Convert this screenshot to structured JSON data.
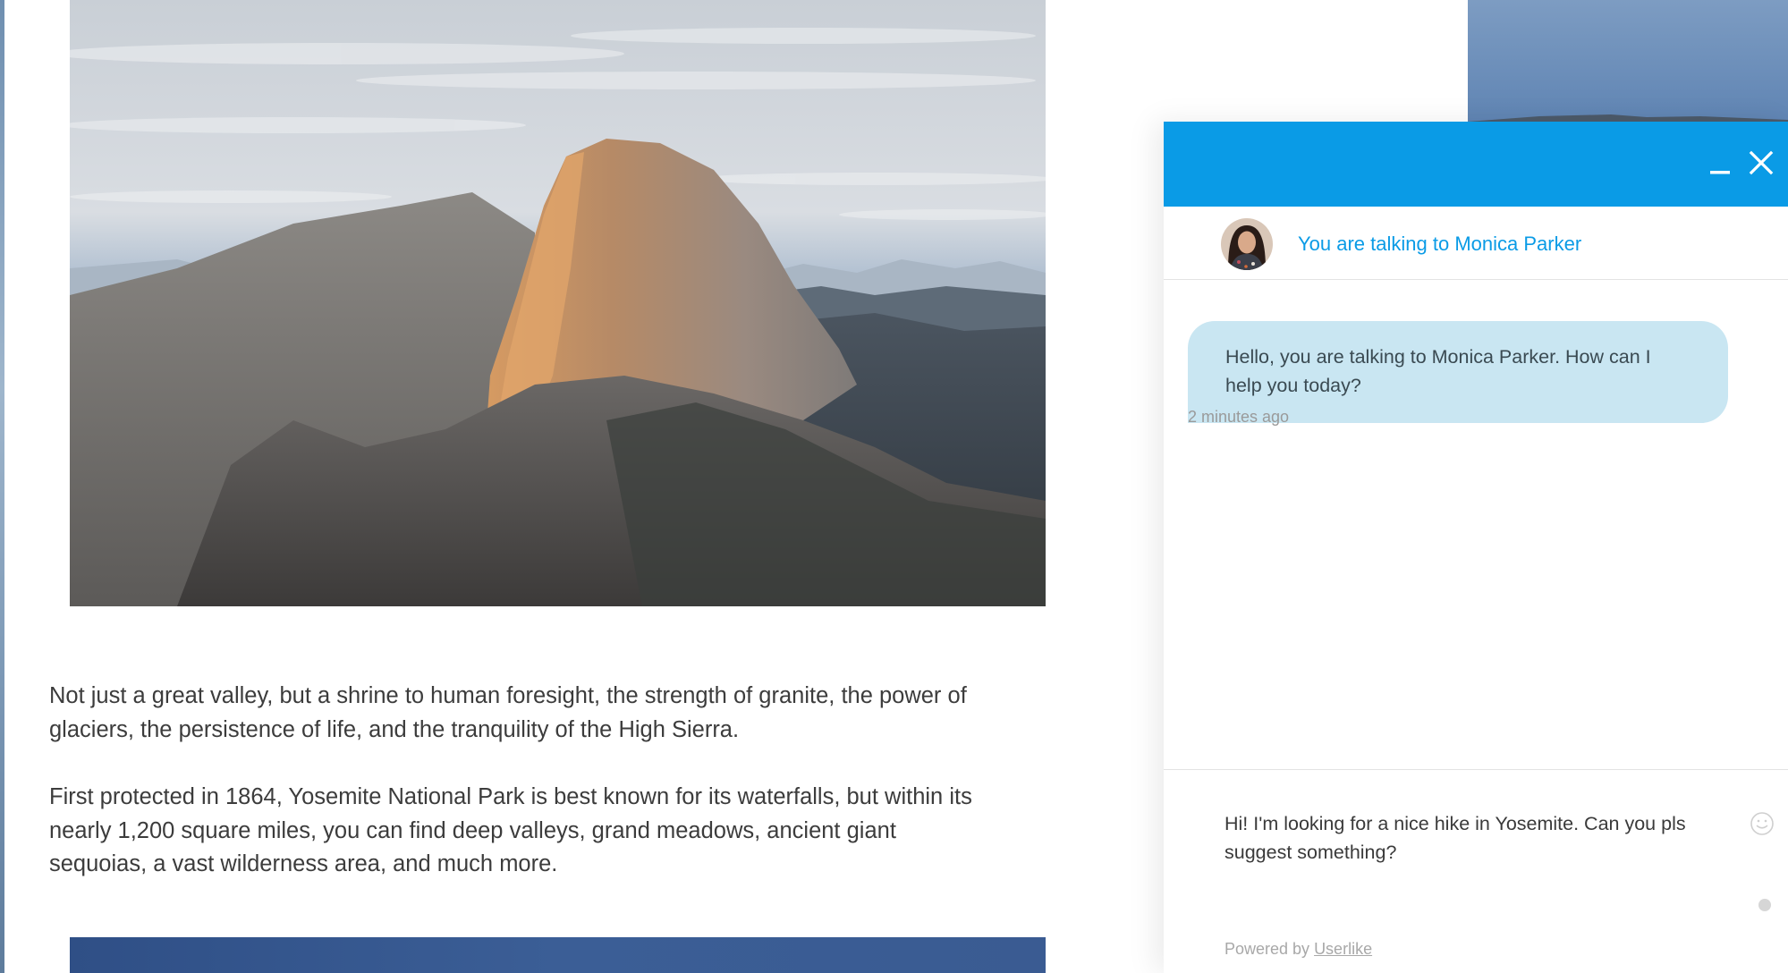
{
  "article": {
    "paragraph_1": "Not just a great valley, but a shrine to human foresight, the strength of granite, the power of glaciers, the persistence of life, and the tranquility of the High Sierra.",
    "paragraph_2": "First protected in 1864, Yosemite National Park is best known for its waterfalls, but within its nearly 1,200 square miles, you can find deep valleys, grand meadows, ancient giant sequoias, a vast wilderness area, and much more."
  },
  "chat": {
    "header": {
      "minimize_icon": "minimize-icon",
      "close_icon": "close-icon",
      "color": "#0a9be6"
    },
    "agent_bar": {
      "label": "You are talking to Monica Parker"
    },
    "messages": [
      {
        "text": "Hello, you are talking to Monica Parker. How can I help you today?",
        "time": "2 minutes ago"
      }
    ],
    "composer": {
      "value": "Hi! I'm looking for a nice hike in Yosemite. Can you pls suggest something?",
      "emoji_icon": "emoji-icon"
    },
    "footer": {
      "powered_prefix": "Powered by ",
      "powered_link": "Userlike"
    },
    "colors": {
      "accent": "#0a9be6",
      "bubble": "#c9e6f2"
    }
  }
}
